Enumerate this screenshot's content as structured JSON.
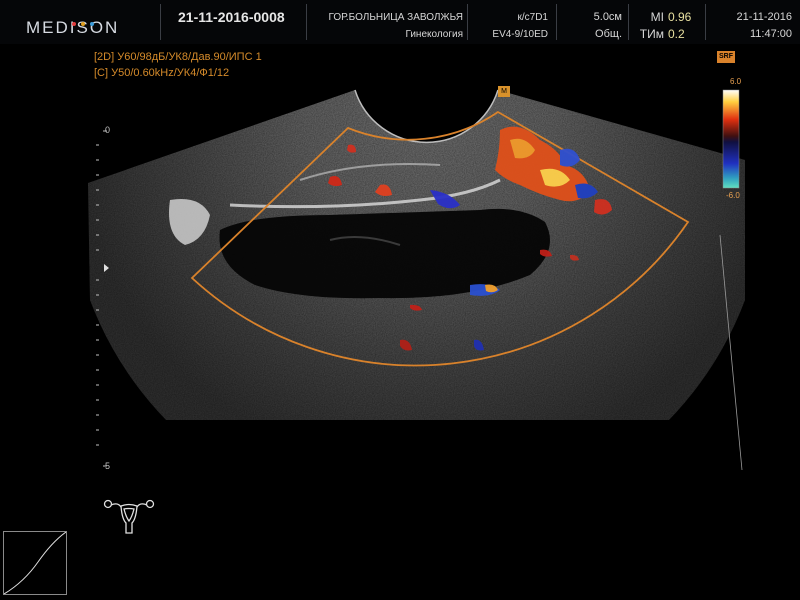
{
  "header": {
    "logo_text": "MEDISON",
    "logo_dot_colors": [
      "#e23c3c",
      "#e0a020",
      "#3a9ad8"
    ],
    "patient_id": "21-11-2016-0008",
    "hospital": "ГОР.БОЛЬНИЦА ЗАВОЛЖЬЯ",
    "department": "Гинекология",
    "probe_preset": "к/с7D1",
    "probe_model": "EV4-9/10ED",
    "depth": "5.0см",
    "preset_type": "Общ.",
    "mi_label": "MI",
    "mi_value": "0.96",
    "tim_label": "ТИм",
    "tim_value": "0.2",
    "date": "21-11-2016",
    "time": "11:47:00"
  },
  "imaging_params": {
    "line_2d": "[2D] У60/98дБ/УК8/Дав.90/ИПС 1",
    "line_color": "[C] У50/0.60kHz/УК4/Ф1/12"
  },
  "color_scale": {
    "top_value": "6.0",
    "bottom_value": "-6.0",
    "label": "SRF"
  },
  "depth_scale": {
    "top_mark": "0",
    "bottom_mark": "5"
  },
  "colors": {
    "parameter_text": "#d48a2a",
    "roi_box": "#d9822b",
    "index_value": "#e8e0a0"
  },
  "icons": {
    "body_marker": "uterus-icon",
    "focus": "focus-arrow-icon",
    "orientation": "orientation-marker-icon"
  }
}
